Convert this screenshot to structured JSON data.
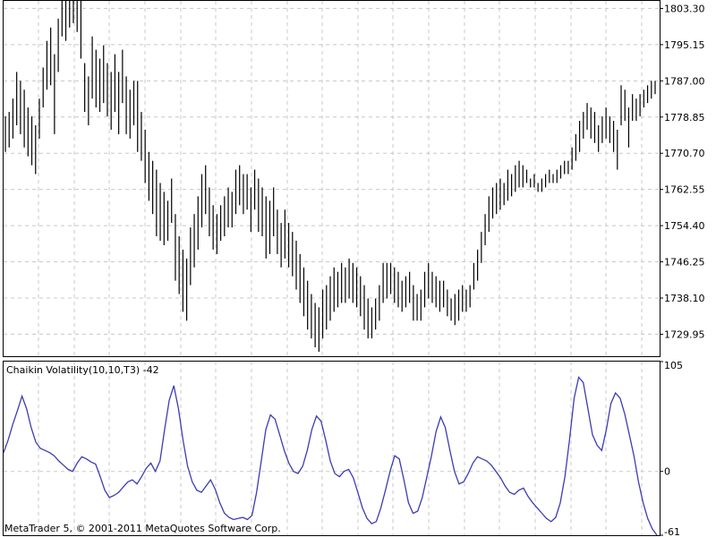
{
  "chart_data": [
    {
      "type": "ohlc",
      "name": "price",
      "ylim": [
        1725.0,
        1805.0
      ],
      "y_ticks": [
        1803.3,
        1795.15,
        1787.0,
        1778.85,
        1770.7,
        1762.55,
        1754.4,
        1746.25,
        1738.1,
        1729.95
      ],
      "y_tick_labels": [
        "1803.30",
        "1795.15",
        "1787.00",
        "1778.85",
        "1770.70",
        "1762.55",
        "1754.40",
        "1746.25",
        "1738.10",
        "1729.95"
      ],
      "grid": true,
      "bars": [
        {
          "high": 1779,
          "low": 1771
        },
        {
          "high": 1780,
          "low": 1772
        },
        {
          "high": 1783,
          "low": 1774
        },
        {
          "high": 1789,
          "low": 1777
        },
        {
          "high": 1787,
          "low": 1775
        },
        {
          "high": 1785,
          "low": 1772
        },
        {
          "high": 1781,
          "low": 1770
        },
        {
          "high": 1779,
          "low": 1768
        },
        {
          "high": 1777,
          "low": 1766
        },
        {
          "high": 1783,
          "low": 1774
        },
        {
          "high": 1790,
          "low": 1781
        },
        {
          "high": 1796,
          "low": 1785
        },
        {
          "high": 1799,
          "low": 1786
        },
        {
          "high": 1793,
          "low": 1775
        },
        {
          "high": 1801,
          "low": 1789
        },
        {
          "high": 1805,
          "low": 1797
        },
        {
          "high": 1805,
          "low": 1796
        },
        {
          "high": 1806,
          "low": 1799
        },
        {
          "high": 1805,
          "low": 1800
        },
        {
          "high": 1805,
          "low": 1798
        },
        {
          "high": 1805,
          "low": 1792
        },
        {
          "high": 1791,
          "low": 1780
        },
        {
          "high": 1788,
          "low": 1777
        },
        {
          "high": 1797,
          "low": 1783
        },
        {
          "high": 1794,
          "low": 1781
        },
        {
          "high": 1792,
          "low": 1780
        },
        {
          "high": 1795,
          "low": 1782
        },
        {
          "high": 1791,
          "low": 1779
        },
        {
          "high": 1789,
          "low": 1776
        },
        {
          "high": 1793,
          "low": 1780
        },
        {
          "high": 1789,
          "low": 1775
        },
        {
          "high": 1794,
          "low": 1782
        },
        {
          "high": 1788,
          "low": 1775
        },
        {
          "high": 1785,
          "low": 1774
        },
        {
          "high": 1787,
          "low": 1777
        },
        {
          "high": 1787,
          "low": 1771
        },
        {
          "high": 1780,
          "low": 1769
        },
        {
          "high": 1776,
          "low": 1764
        },
        {
          "high": 1771,
          "low": 1760
        },
        {
          "high": 1769,
          "low": 1757
        },
        {
          "high": 1767,
          "low": 1752
        },
        {
          "high": 1764,
          "low": 1751
        },
        {
          "high": 1762,
          "low": 1750
        },
        {
          "high": 1760,
          "low": 1751
        },
        {
          "high": 1765,
          "low": 1755
        },
        {
          "high": 1757,
          "low": 1742
        },
        {
          "high": 1752,
          "low": 1739
        },
        {
          "high": 1749,
          "low": 1735
        },
        {
          "high": 1747,
          "low": 1733
        },
        {
          "high": 1754,
          "low": 1741
        },
        {
          "high": 1757,
          "low": 1745
        },
        {
          "high": 1761,
          "low": 1749
        },
        {
          "high": 1766,
          "low": 1754
        },
        {
          "high": 1768,
          "low": 1757
        },
        {
          "high": 1763,
          "low": 1752
        },
        {
          "high": 1759,
          "low": 1749
        },
        {
          "high": 1757,
          "low": 1748
        },
        {
          "high": 1759,
          "low": 1751
        },
        {
          "high": 1761,
          "low": 1752
        },
        {
          "high": 1763,
          "low": 1754
        },
        {
          "high": 1762,
          "low": 1754
        },
        {
          "high": 1767,
          "low": 1757
        },
        {
          "high": 1768,
          "low": 1759
        },
        {
          "high": 1766,
          "low": 1757
        },
        {
          "high": 1766,
          "low": 1758
        },
        {
          "high": 1763,
          "low": 1753
        },
        {
          "high": 1767,
          "low": 1758
        },
        {
          "high": 1765,
          "low": 1753
        },
        {
          "high": 1763,
          "low": 1752
        },
        {
          "high": 1761,
          "low": 1747
        },
        {
          "high": 1760,
          "low": 1748
        },
        {
          "high": 1763,
          "low": 1752
        },
        {
          "high": 1758,
          "low": 1748
        },
        {
          "high": 1755,
          "low": 1745
        },
        {
          "high": 1758,
          "low": 1747
        },
        {
          "high": 1755,
          "low": 1745
        },
        {
          "high": 1753,
          "low": 1743
        },
        {
          "high": 1751,
          "low": 1740
        },
        {
          "high": 1748,
          "low": 1737
        },
        {
          "high": 1745,
          "low": 1734
        },
        {
          "high": 1742,
          "low": 1731
        },
        {
          "high": 1739,
          "low": 1729
        },
        {
          "high": 1737,
          "low": 1727
        },
        {
          "high": 1736,
          "low": 1726
        },
        {
          "high": 1740,
          "low": 1729
        },
        {
          "high": 1741,
          "low": 1731
        },
        {
          "high": 1743,
          "low": 1733
        },
        {
          "high": 1745,
          "low": 1735
        },
        {
          "high": 1744,
          "low": 1736
        },
        {
          "high": 1746,
          "low": 1737
        },
        {
          "high": 1745,
          "low": 1737
        },
        {
          "high": 1747,
          "low": 1738
        },
        {
          "high": 1746,
          "low": 1737
        },
        {
          "high": 1745,
          "low": 1736
        },
        {
          "high": 1743,
          "low": 1734
        },
        {
          "high": 1741,
          "low": 1731
        },
        {
          "high": 1738,
          "low": 1729
        },
        {
          "high": 1736,
          "low": 1729
        },
        {
          "high": 1738,
          "low": 1731
        },
        {
          "high": 1741,
          "low": 1733
        },
        {
          "high": 1746,
          "low": 1737
        },
        {
          "high": 1746,
          "low": 1738
        },
        {
          "high": 1746,
          "low": 1739
        },
        {
          "high": 1745,
          "low": 1737
        },
        {
          "high": 1744,
          "low": 1736
        },
        {
          "high": 1742,
          "low": 1735
        },
        {
          "high": 1743,
          "low": 1736
        },
        {
          "high": 1744,
          "low": 1737
        },
        {
          "high": 1741,
          "low": 1733
        },
        {
          "high": 1739,
          "low": 1733
        },
        {
          "high": 1740,
          "low": 1733
        },
        {
          "high": 1744,
          "low": 1736
        },
        {
          "high": 1746,
          "low": 1738
        },
        {
          "high": 1744,
          "low": 1737
        },
        {
          "high": 1743,
          "low": 1736
        },
        {
          "high": 1742,
          "low": 1735
        },
        {
          "high": 1742,
          "low": 1736
        },
        {
          "high": 1740,
          "low": 1734
        },
        {
          "high": 1738,
          "low": 1733
        },
        {
          "high": 1739,
          "low": 1732
        },
        {
          "high": 1740,
          "low": 1733
        },
        {
          "high": 1741,
          "low": 1735
        },
        {
          "high": 1740,
          "low": 1735
        },
        {
          "high": 1741,
          "low": 1736
        },
        {
          "high": 1746,
          "low": 1740
        },
        {
          "high": 1749,
          "low": 1742
        },
        {
          "high": 1753,
          "low": 1746
        },
        {
          "high": 1757,
          "low": 1750
        },
        {
          "high": 1761,
          "low": 1753
        },
        {
          "high": 1763,
          "low": 1756
        },
        {
          "high": 1764,
          "low": 1757
        },
        {
          "high": 1765,
          "low": 1758
        },
        {
          "high": 1764,
          "low": 1759
        },
        {
          "high": 1767,
          "low": 1760
        },
        {
          "high": 1766,
          "low": 1761
        },
        {
          "high": 1768,
          "low": 1762
        },
        {
          "high": 1769,
          "low": 1763
        },
        {
          "high": 1768,
          "low": 1763
        },
        {
          "high": 1767,
          "low": 1764
        },
        {
          "high": 1765,
          "low": 1763
        },
        {
          "high": 1766,
          "low": 1763
        },
        {
          "high": 1764,
          "low": 1762
        },
        {
          "high": 1765,
          "low": 1762
        },
        {
          "high": 1766,
          "low": 1763
        },
        {
          "high": 1767,
          "low": 1764
        },
        {
          "high": 1766,
          "low": 1764
        },
        {
          "high": 1767,
          "low": 1764
        },
        {
          "high": 1768,
          "low": 1765
        },
        {
          "high": 1769,
          "low": 1766
        },
        {
          "high": 1769,
          "low": 1766
        },
        {
          "high": 1772,
          "low": 1767
        },
        {
          "high": 1775,
          "low": 1769
        },
        {
          "high": 1778,
          "low": 1771
        },
        {
          "high": 1780,
          "low": 1774
        },
        {
          "high": 1782,
          "low": 1776
        },
        {
          "high": 1781,
          "low": 1774
        },
        {
          "high": 1780,
          "low": 1773
        },
        {
          "high": 1777,
          "low": 1771
        },
        {
          "high": 1779,
          "low": 1773
        },
        {
          "high": 1781,
          "low": 1774
        },
        {
          "high": 1779,
          "low": 1773
        },
        {
          "high": 1778,
          "low": 1771
        },
        {
          "high": 1776,
          "low": 1767
        },
        {
          "high": 1786,
          "low": 1777
        },
        {
          "high": 1785,
          "low": 1778
        },
        {
          "high": 1781,
          "low": 1772
        },
        {
          "high": 1784,
          "low": 1778
        },
        {
          "high": 1783,
          "low": 1778
        },
        {
          "high": 1784,
          "low": 1779
        },
        {
          "high": 1785,
          "low": 1781
        },
        {
          "high": 1786,
          "low": 1782
        },
        {
          "high": 1787,
          "low": 1783
        },
        {
          "high": 1787,
          "low": 1784
        }
      ]
    },
    {
      "type": "line",
      "name": "chaikin_volatility",
      "label": "Chaikin Volatility(10,10,T3) -42",
      "ylim": [
        -61,
        105
      ],
      "y_ticks": [
        105,
        0,
        -61
      ],
      "y_tick_labels": [
        "105",
        "0",
        "-61"
      ],
      "color": "#3c3cb4",
      "grid": true,
      "series": [
        {
          "name": "",
          "values": [
            18,
            30,
            45,
            58,
            72,
            60,
            42,
            28,
            22,
            20,
            18,
            15,
            10,
            6,
            2,
            0,
            8,
            14,
            12,
            9,
            7,
            -5,
            -18,
            -25,
            -23,
            -20,
            -15,
            -10,
            -8,
            -12,
            -5,
            3,
            8,
            0,
            10,
            40,
            68,
            82,
            60,
            30,
            5,
            -10,
            -18,
            -20,
            -14,
            -8,
            -17,
            -30,
            -40,
            -44,
            -46,
            -45,
            -44,
            -46,
            -42,
            -20,
            10,
            40,
            54,
            50,
            35,
            20,
            8,
            0,
            -2,
            5,
            20,
            40,
            53,
            48,
            30,
            10,
            -2,
            -5,
            0,
            2,
            -6,
            -20,
            -35,
            -45,
            -50,
            -48,
            -35,
            -18,
            0,
            15,
            12,
            -8,
            -30,
            -40,
            -38,
            -25,
            -5,
            15,
            38,
            52,
            42,
            20,
            0,
            -12,
            -10,
            -2,
            8,
            14,
            12,
            10,
            6,
            0,
            -6,
            -14,
            -20,
            -22,
            -18,
            -16,
            -24,
            -30,
            -35,
            -40,
            -45,
            -48,
            -44,
            -30,
            -5,
            30,
            70,
            90,
            85,
            60,
            35,
            25,
            20,
            40,
            65,
            75,
            70,
            55,
            35,
            15,
            -10,
            -30,
            -45,
            -55,
            -61
          ]
        }
      ]
    }
  ],
  "price_pane": {},
  "indicator_pane": {
    "label": "Chaikin Volatility(10,10,T3) -42"
  },
  "footer": {
    "credit": "MetaTrader 5, © 2001-2011 MetaQuotes Software Corp."
  }
}
